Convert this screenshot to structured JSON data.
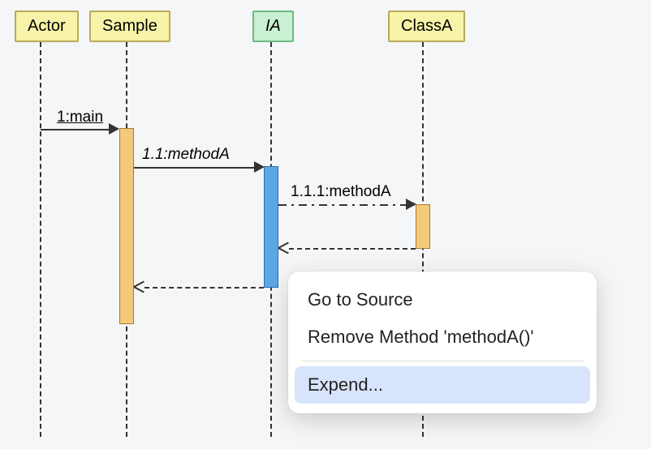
{
  "participants": {
    "actor": "Actor",
    "sample": "Sample",
    "ia": "IA",
    "classA": "ClassA"
  },
  "messages": {
    "main": "1:main",
    "methodA1": "1.1:methodA",
    "methodA2": "1.1.1:methodA"
  },
  "contextMenu": {
    "goToSource": "Go to Source",
    "removeMethod": "Remove Method 'methodA()'",
    "expend": "Expend..."
  }
}
